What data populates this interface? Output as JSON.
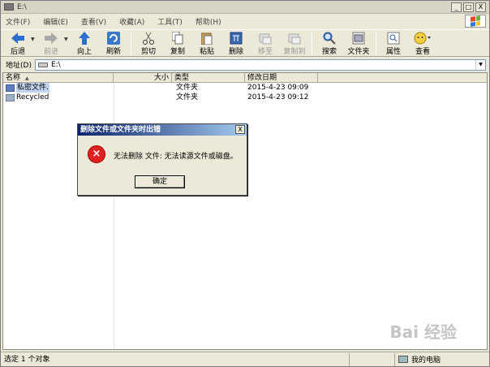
{
  "window": {
    "title": "E:\\",
    "min_label": "_",
    "max_label": "□",
    "close_label": "X"
  },
  "menu": [
    "文件(F)",
    "编辑(E)",
    "查看(V)",
    "收藏(A)",
    "工具(T)",
    "帮助(H)"
  ],
  "toolbar": {
    "back": "后退",
    "forward": "前进",
    "up": "向上",
    "refresh": "刷新",
    "cut": "剪切",
    "copy": "复制",
    "paste": "粘贴",
    "delete": "删除",
    "move_to": "移至",
    "copy_to": "复制到",
    "search": "搜索",
    "folders": "文件夹",
    "properties": "属性",
    "views": "查看"
  },
  "address": {
    "label": "地址(D)",
    "value": "E:\\"
  },
  "columns": {
    "name": "名称",
    "size": "大小",
    "type": "类型",
    "date": "修改日期"
  },
  "rows": [
    {
      "name": "私密文件.",
      "size": "",
      "type": "文件夹",
      "date": "2015-4-23 09:09"
    },
    {
      "name": "Recycled",
      "size": "",
      "type": "文件夹",
      "date": "2015-4-23 09:12"
    }
  ],
  "dialog": {
    "title": "删除文件或文件夹时出错",
    "close": "X",
    "message": "无法删除 文件: 无法读源文件或磁盘。",
    "ok": "确定"
  },
  "status": {
    "left": "选定 1 个对象",
    "right": "我的电脑"
  },
  "watermark": "Bai 经验",
  "colors": {
    "title_gradient_start": "#0a246a",
    "title_gradient_end": "#a6caf0",
    "error": "#e02020"
  }
}
